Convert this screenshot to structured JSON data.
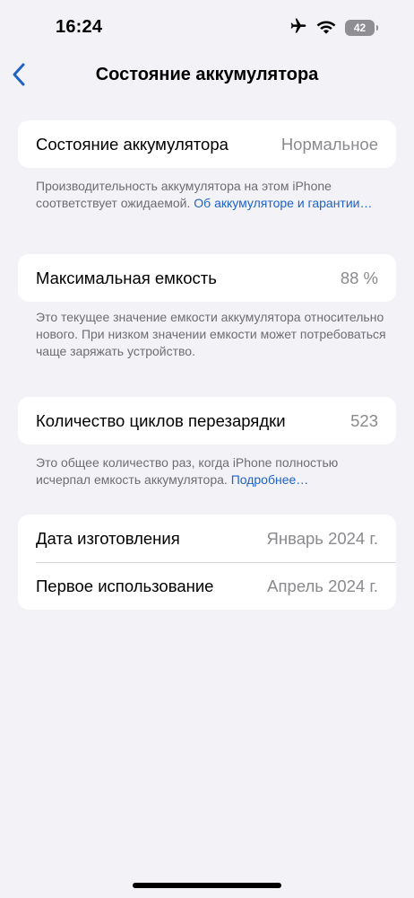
{
  "status_bar": {
    "time": "16:24",
    "battery_level": "42",
    "icons": [
      "airplane-icon",
      "wifi-icon",
      "battery-icon"
    ]
  },
  "nav": {
    "back_icon": "chevron-left-icon",
    "title": "Состояние аккумулятора"
  },
  "battery_health": {
    "label": "Состояние аккумулятора",
    "value": "Нормальное",
    "footnote": "Производительность аккумулятора на этом iPhone соответствует ожидаемой.",
    "footnote_link": "Об аккумуляторе и гарантии…"
  },
  "max_capacity": {
    "label": "Максимальная емкость",
    "value": "88 %",
    "footnote": "Это текущее значение емкости аккумулятора относительно нового. При низком значении емкости может потребоваться чаще заряжать устройство."
  },
  "cycle_count": {
    "label": "Количество циклов перезарядки",
    "value": "523",
    "footnote": "Это общее количество раз, когда iPhone полностью исчерпал емкость аккумулятора.",
    "footnote_link": "Подробнее…"
  },
  "dates": {
    "manufacture_label": "Дата изготовления",
    "manufacture_value": "Январь 2024 г.",
    "first_use_label": "Первое использование",
    "first_use_value": "Апрель 2024 г."
  },
  "colors": {
    "background": "#f2f2f7",
    "accent": "#1f63c6",
    "secondary_text": "#8a8a8e"
  }
}
